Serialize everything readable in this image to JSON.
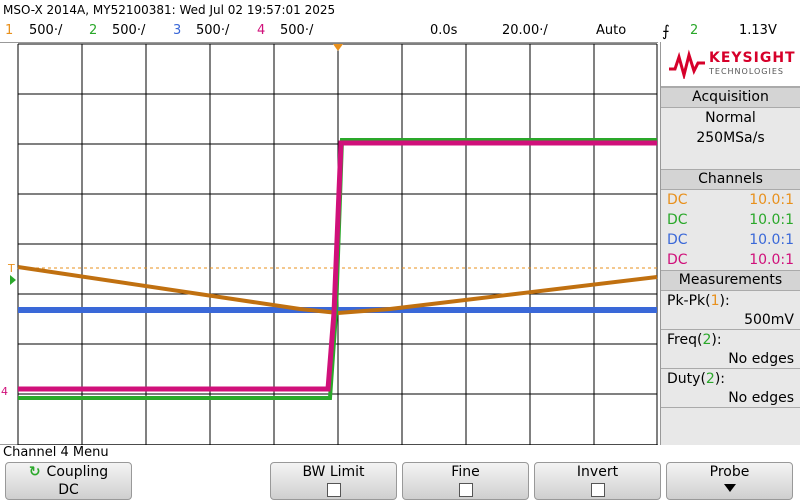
{
  "title": "MSO-X 2014A, MY52100381: Wed Jul 02 19:57:01 2025",
  "channels_bar": [
    {
      "num": "1",
      "scale": "500‧/",
      "color": "#e8901c"
    },
    {
      "num": "2",
      "scale": "500‧/",
      "color": "#2aa82a"
    },
    {
      "num": "3",
      "scale": "500‧/",
      "color": "#3a68d8"
    },
    {
      "num": "4",
      "scale": "500‧/",
      "color": "#d0107a"
    }
  ],
  "timebase": {
    "delay": "0.0s",
    "scale": "20.00‧/",
    "mode": "Auto"
  },
  "trigger": {
    "channel": "2",
    "level": "1.13V",
    "icon": "rising-edge-trigger-icon"
  },
  "brand": {
    "name": "KEYSIGHT",
    "sub": "TECHNOLOGIES"
  },
  "acquisition": {
    "title": "Acquisition",
    "mode": "Normal",
    "rate": "250MSa/s"
  },
  "channels_panel": {
    "title": "Channels",
    "rows": [
      {
        "coupling": "DC",
        "probe": "10.0:1",
        "color": "#e8901c"
      },
      {
        "coupling": "DC",
        "probe": "10.0:1",
        "color": "#2aa82a"
      },
      {
        "coupling": "DC",
        "probe": "10.0:1",
        "color": "#3a68d8"
      },
      {
        "coupling": "DC",
        "probe": "10.0:1",
        "color": "#d0107a"
      }
    ]
  },
  "measurements": {
    "title": "Measurements",
    "items": [
      {
        "label": "Pk-Pk",
        "src": "1",
        "src_color": "#e8901c",
        "value": "500mV"
      },
      {
        "label": "Freq",
        "src": "2",
        "src_color": "#2aa82a",
        "value": "No edges"
      },
      {
        "label": "Duty",
        "src": "2",
        "src_color": "#2aa82a",
        "value": "No edges"
      }
    ]
  },
  "menu": {
    "title": "Channel 4 Menu",
    "softkeys": [
      {
        "label": "Coupling",
        "value": "DC"
      },
      {
        "label": "BW Limit",
        "value": ""
      },
      {
        "label": "Fine",
        "value": ""
      },
      {
        "label": "Invert",
        "value": ""
      },
      {
        "label": "Probe",
        "value": ""
      }
    ]
  },
  "markers": {
    "trigger_level": "T",
    "ch4_ground": "4"
  }
}
